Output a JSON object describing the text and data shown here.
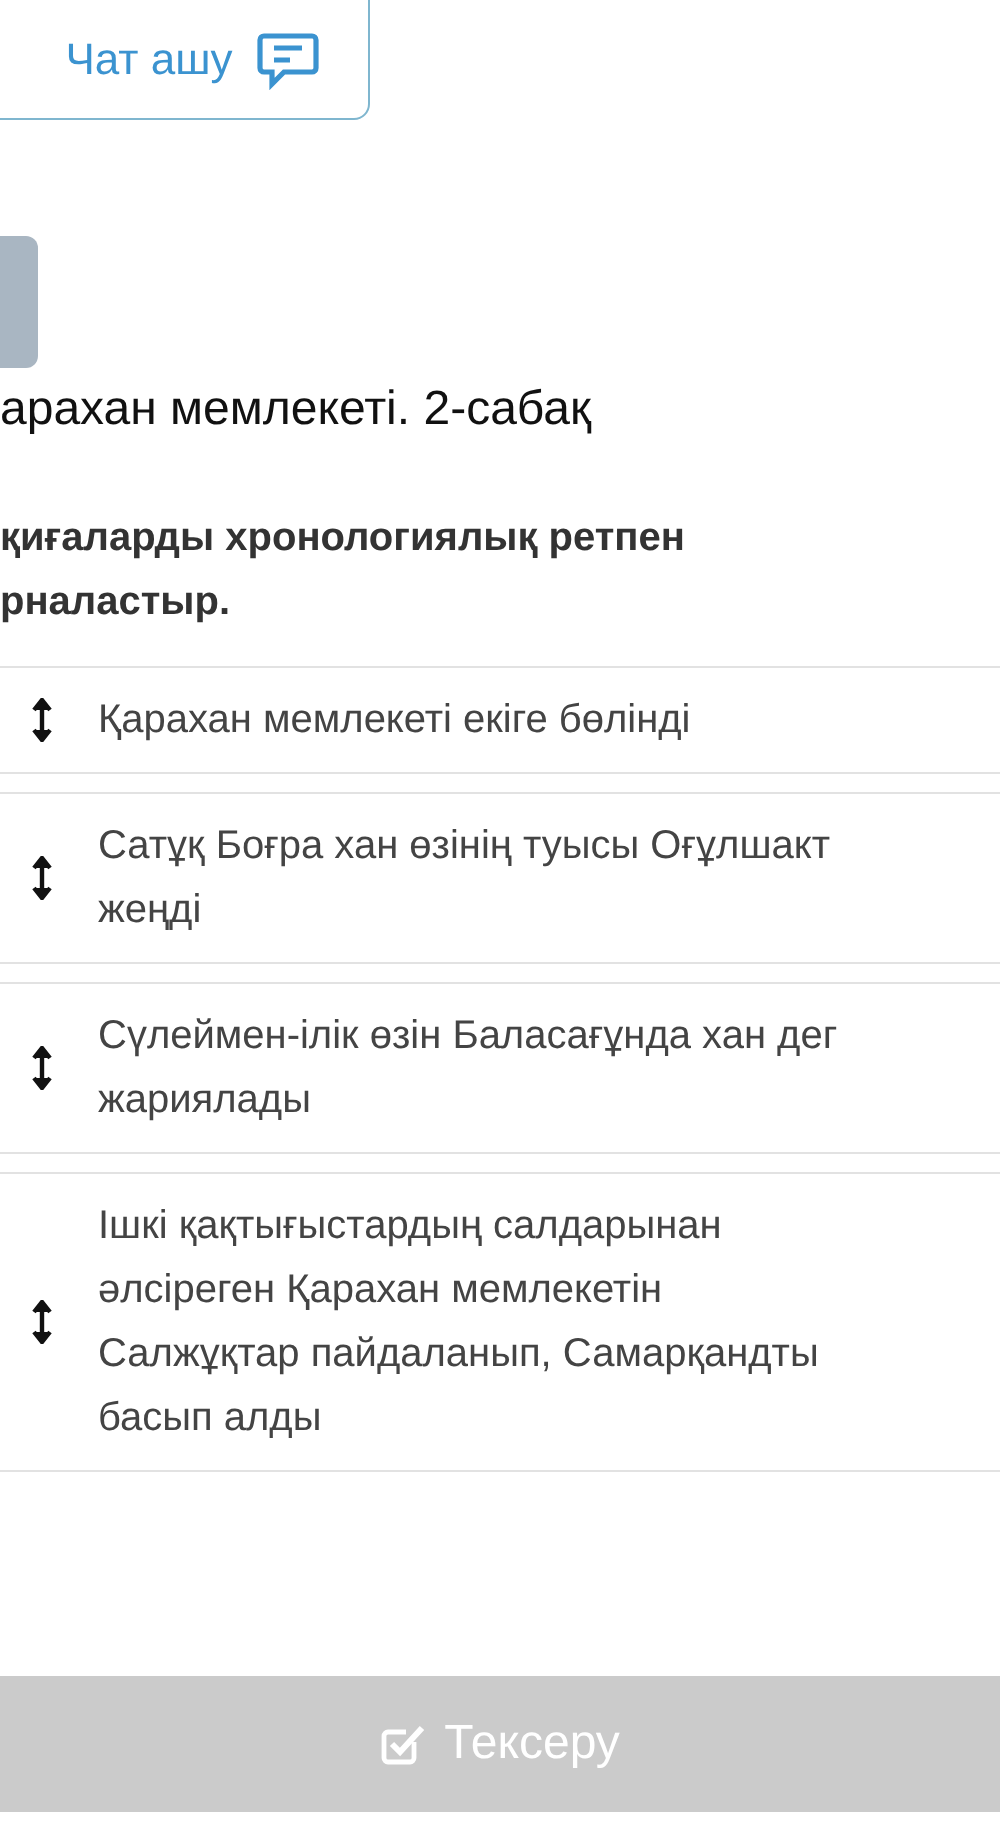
{
  "chat_button": {
    "label": "Чат ашу"
  },
  "title": "арахан мемлекеті. 2-сабақ",
  "instruction": [
    "қиғаларды хронологиялық ретпен",
    "рналастыр."
  ],
  "items": [
    {
      "lines": [
        "Қарахан мемлекеті екіге бөлінді"
      ]
    },
    {
      "lines": [
        "Сатұқ Боғра хан өзінің туысы Оғұлшакт",
        "жеңді"
      ]
    },
    {
      "lines": [
        "Сүлеймен-ілік өзін Баласағұнда хан дег",
        "жариялады"
      ]
    },
    {
      "lines": [
        "Ішкі қақтығыстардың салдарынан",
        "әлсіреген Қарахан мемлекетін",
        "Салжұқтар пайдаланып, Самарқандты",
        "басып алды"
      ]
    }
  ],
  "check_button": {
    "label": "Тексеру",
    "disabled": true
  }
}
